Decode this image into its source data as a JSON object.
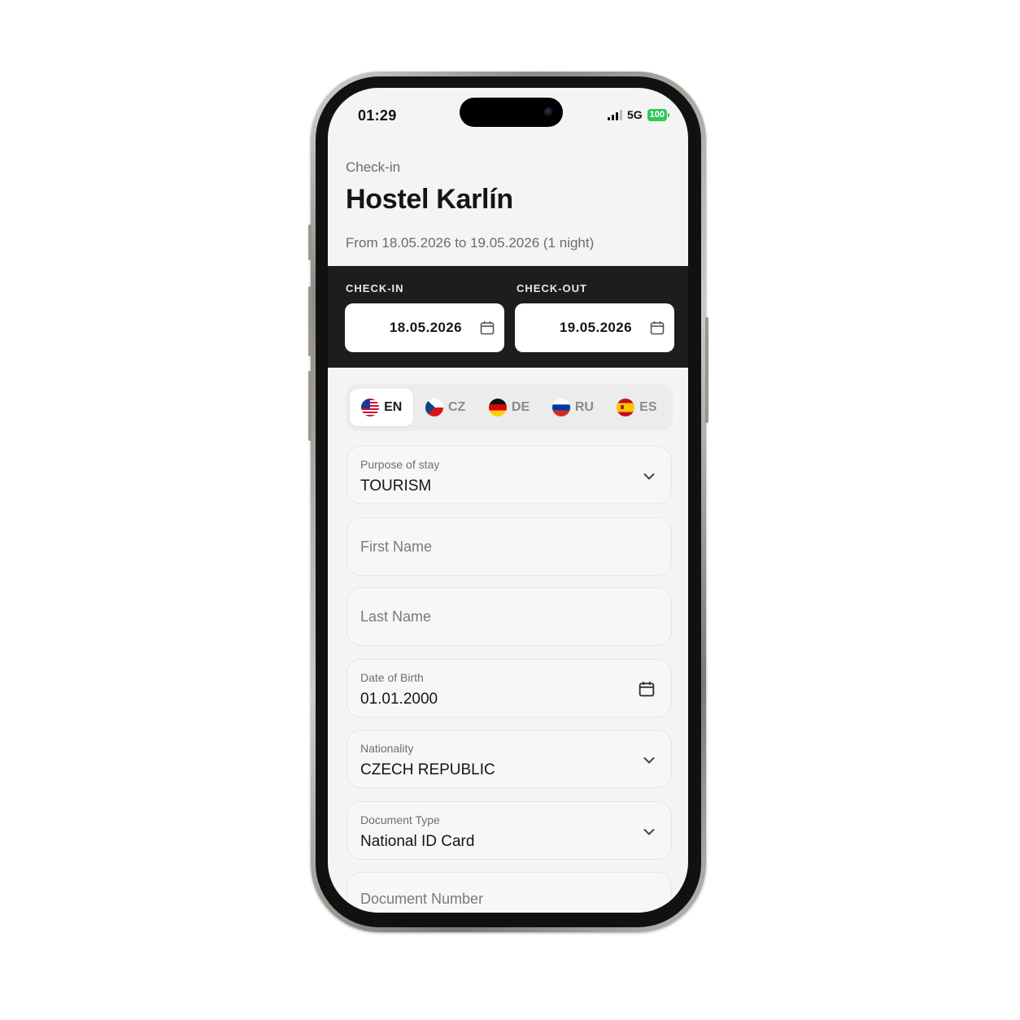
{
  "status_bar": {
    "time": "01:29",
    "network": "5G",
    "battery": "100"
  },
  "header": {
    "kicker": "Check-in",
    "title": "Hostel Karlín",
    "date_range": "From 18.05.2026 to 19.05.2026 (1 night)"
  },
  "dates": {
    "checkin_label": "CHECK-IN",
    "checkin_value": "18.05.2026",
    "checkout_label": "CHECK-OUT",
    "checkout_value": "19.05.2026"
  },
  "languages": [
    {
      "code": "EN",
      "flag": "us-flag-icon",
      "active": true
    },
    {
      "code": "CZ",
      "flag": "cz-flag-icon",
      "active": false
    },
    {
      "code": "DE",
      "flag": "de-flag-icon",
      "active": false
    },
    {
      "code": "RU",
      "flag": "ru-flag-icon",
      "active": false
    },
    {
      "code": "ES",
      "flag": "es-flag-icon",
      "active": false
    }
  ],
  "form": {
    "purpose": {
      "label": "Purpose of stay",
      "value": "TOURISM"
    },
    "first_name": {
      "placeholder": "First Name"
    },
    "last_name": {
      "placeholder": "Last Name"
    },
    "dob": {
      "label": "Date of Birth",
      "value": "01.01.2000"
    },
    "nationality": {
      "label": "Nationality",
      "value": "CZECH REPUBLIC"
    },
    "document_type": {
      "label": "Document Type",
      "value": "National ID Card"
    },
    "document_number": {
      "placeholder": "Document Number"
    }
  },
  "colors": {
    "dark_band": "#1d1d1d",
    "battery": "#34c759",
    "screen_bg": "#f4f4f4"
  }
}
